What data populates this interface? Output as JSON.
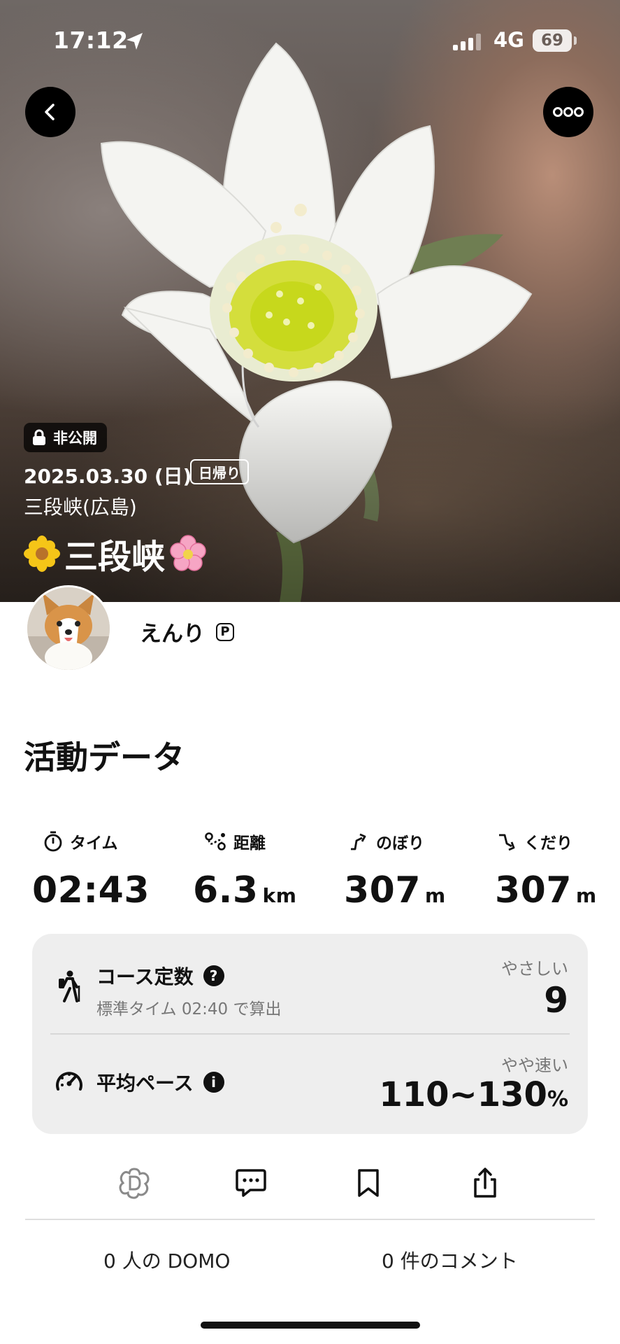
{
  "status_bar": {
    "time": "17:12",
    "network": "4G",
    "battery": "69"
  },
  "activity": {
    "visibility": "非公開",
    "date": "2025.03.30 (日)",
    "trip_type": "日帰り",
    "area": "三段峡(広島)",
    "title": "三段峡",
    "title_emoji_left": "yellow-flower-icon",
    "title_emoji_right": "pink-flower-icon"
  },
  "user": {
    "name": "えんり",
    "badge": "P"
  },
  "section_title": "活動データ",
  "stats": [
    {
      "label": "タイム",
      "value": "02:43",
      "unit": "",
      "icon": "timer-icon"
    },
    {
      "label": "距離",
      "value": "6.3",
      "unit": "km",
      "icon": "route-icon"
    },
    {
      "label": "のぼり",
      "value": "307",
      "unit": "m",
      "icon": "ascent-icon"
    },
    {
      "label": "くだり",
      "value": "307",
      "unit": "m",
      "icon": "descent-icon"
    }
  ],
  "course": {
    "label": "コース定数",
    "help": "?",
    "sub": "標準タイム 02:40 で算出",
    "tag": "やさしい",
    "value": "9"
  },
  "pace": {
    "label": "平均ペース",
    "info": "i",
    "tag": "やや速い",
    "value": "110~130",
    "unit": "%"
  },
  "actions": [
    "domo-icon",
    "comment-icon",
    "bookmark-icon",
    "share-icon"
  ],
  "counts": {
    "domo": "0 人の DOMO",
    "comments": "0 件のコメント"
  }
}
